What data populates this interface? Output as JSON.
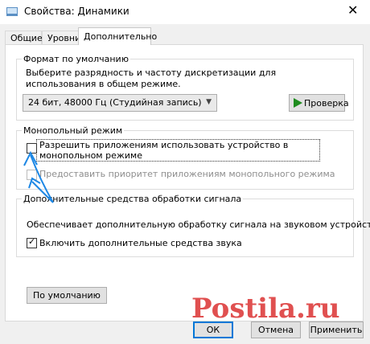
{
  "window": {
    "title": "Свойства: Динамики",
    "close_label": "✕"
  },
  "tabs": [
    {
      "label": "Общие",
      "active": false
    },
    {
      "label": "Уровни",
      "active": false
    },
    {
      "label": "Дополнительно",
      "active": true
    }
  ],
  "default_format": {
    "legend": "Формат по умолчанию",
    "description": "Выберите разрядность и частоту дискретизации для использования в общем режиме.",
    "selected_format": "24 бит, 48000 Гц (Студийная запись)",
    "test_button": "Проверка"
  },
  "exclusive_mode": {
    "legend": "Монопольный режим",
    "allow_exclusive": {
      "label": "Разрешить приложениям использовать устройство в монопольном режиме",
      "checked": false
    },
    "give_priority": {
      "label": "Предоставить приоритет приложениям монопольного режима",
      "checked": false,
      "disabled": true
    }
  },
  "signal_enhancements": {
    "legend": "Дополнительные средства обработки сигнала",
    "description": "Обеспечивает дополнительную обработку сигнала на звуковом устройстве",
    "enable": {
      "label": "Включить дополнительные средства звука",
      "checked": true
    }
  },
  "restore_defaults_button": "По умолчанию",
  "footer": {
    "ok": "ОК",
    "cancel": "Отмена",
    "apply": "Применить"
  },
  "watermark_text": "Postila.ru",
  "colors": {
    "accent": "#0078d7",
    "play_icon": "#1e8c1e",
    "annotation": "#1e88e5",
    "watermark": "#e05050"
  }
}
